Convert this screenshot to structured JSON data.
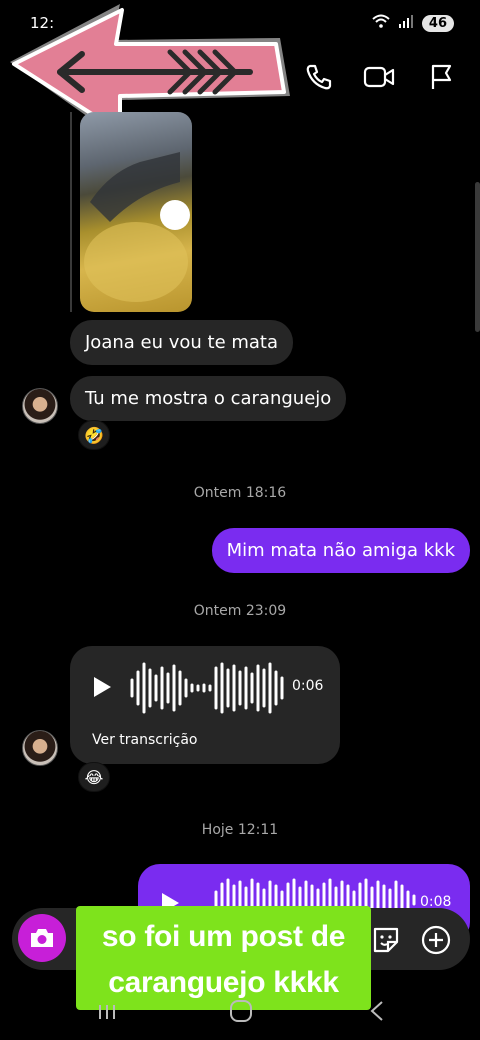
{
  "status_bar": {
    "time": "12:",
    "battery": "46"
  },
  "header": {
    "icons": [
      "video-call-icon",
      "phone-icon",
      "camera-video-icon",
      "flag-icon"
    ]
  },
  "sticker": {
    "name": "back-arrow-sticker"
  },
  "messages": {
    "thumb_reaction": "😋",
    "msg1": "Joana eu vou te mata",
    "msg2": "Tu me mostra o caranguejo",
    "msg2_reaction": "🤣",
    "ts1": "Ontem 18:16",
    "msg3": "Mim mata não amiga kkk",
    "ts2": "Ontem 23:09",
    "voice_in_duration": "0:06",
    "voice_in_transcription": "Ver transcrição",
    "voice_in_reaction": "😂",
    "ts3": "Hoje 12:11",
    "voice_out_duration": "0:08"
  },
  "caption": {
    "line1": "so foi um post de",
    "line2": "caranguejo kkkk"
  },
  "colors": {
    "outgoing_bubble": "#7a2cf0",
    "incoming_bubble": "#262626",
    "camera_button": "#c71fd8",
    "caption_bg": "#7ee31c"
  }
}
